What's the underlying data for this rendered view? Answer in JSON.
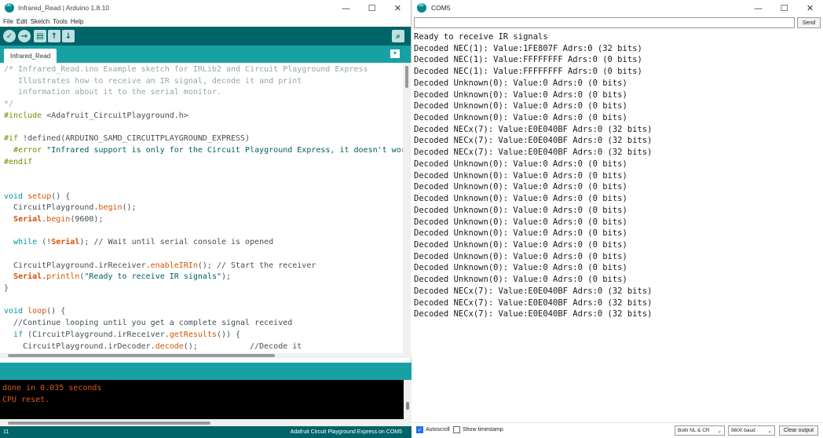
{
  "ide": {
    "title": "Infrared_Read | Arduino 1.8.10",
    "window_controls": [
      "—",
      "☐",
      "✕"
    ],
    "menu": [
      "File",
      "Edit",
      "Sketch",
      "Tools",
      "Help"
    ],
    "toolbar": {
      "verify": "✓",
      "upload": "→",
      "new": "▤",
      "open": "↑",
      "save": "↓",
      "serial_monitor": "⌕"
    },
    "tab_label": "Infrared_Read",
    "tab_menu_icon": "▼",
    "console_lines": [
      "done in 0.035 seconds",
      "CPU reset."
    ],
    "status_line": "11",
    "status_board": "Adafruit Circuit Playground Express on COM5"
  },
  "code_lines": [
    [
      {
        "t": "/* Infrared_Read.ino Example sketch for IRLib2 and Circuit Playground Express",
        "c": "com"
      }
    ],
    [
      {
        "t": "   Illustrates how to receive an IR signal, decode it and print",
        "c": "com"
      }
    ],
    [
      {
        "t": "   information about it to the serial monitor.",
        "c": "com"
      }
    ],
    [
      {
        "t": "*/",
        "c": "com"
      }
    ],
    [
      {
        "t": "#include ",
        "c": "pre"
      },
      {
        "t": "<Adafruit_CircuitPlayground.h>",
        "c": ""
      }
    ],
    [
      {
        "t": "",
        "c": ""
      }
    ],
    [
      {
        "t": "#if ",
        "c": "pre"
      },
      {
        "t": "!defined(ARDUINO_SAMD_CIRCUITPLAYGROUND_EXPRESS)",
        "c": ""
      }
    ],
    [
      {
        "t": "  #error ",
        "c": "pre"
      },
      {
        "t": "\"Infrared support is only for the Circuit Playground Express, it doesn't work with the Classic version\"",
        "c": "str"
      }
    ],
    [
      {
        "t": "#endif",
        "c": "pre"
      }
    ],
    [
      {
        "t": "",
        "c": ""
      }
    ],
    [
      {
        "t": "",
        "c": ""
      }
    ],
    [
      {
        "t": "void ",
        "c": "kw"
      },
      {
        "t": "setup",
        "c": "fn"
      },
      {
        "t": "() {",
        "c": ""
      }
    ],
    [
      {
        "t": "  CircuitPlayground.",
        "c": ""
      },
      {
        "t": "begin",
        "c": "fn"
      },
      {
        "t": "();",
        "c": ""
      }
    ],
    [
      {
        "t": "  ",
        "c": ""
      },
      {
        "t": "Serial",
        "c": "bold"
      },
      {
        "t": ".",
        "c": ""
      },
      {
        "t": "begin",
        "c": "fn"
      },
      {
        "t": "(9600);",
        "c": ""
      }
    ],
    [
      {
        "t": "",
        "c": ""
      }
    ],
    [
      {
        "t": "  ",
        "c": ""
      },
      {
        "t": "while",
        "c": "kw"
      },
      {
        "t": " (!",
        "c": ""
      },
      {
        "t": "Serial",
        "c": "bold"
      },
      {
        "t": "); // Wait until serial console is opened",
        "c": ""
      }
    ],
    [
      {
        "t": "",
        "c": ""
      }
    ],
    [
      {
        "t": "  CircuitPlayground.irReceiver.",
        "c": ""
      },
      {
        "t": "enableIRIn",
        "c": "fn"
      },
      {
        "t": "(); // Start the receiver",
        "c": ""
      }
    ],
    [
      {
        "t": "  ",
        "c": ""
      },
      {
        "t": "Serial",
        "c": "bold"
      },
      {
        "t": ".",
        "c": ""
      },
      {
        "t": "println",
        "c": "fn"
      },
      {
        "t": "(",
        "c": ""
      },
      {
        "t": "\"Ready to receive IR signals\"",
        "c": "str"
      },
      {
        "t": ");",
        "c": ""
      }
    ],
    [
      {
        "t": "}",
        "c": ""
      }
    ],
    [
      {
        "t": "",
        "c": ""
      }
    ],
    [
      {
        "t": "void ",
        "c": "kw"
      },
      {
        "t": "loop",
        "c": "fn"
      },
      {
        "t": "() {",
        "c": ""
      }
    ],
    [
      {
        "t": "  //Continue looping until you get a complete signal received",
        "c": ""
      }
    ],
    [
      {
        "t": "  ",
        "c": ""
      },
      {
        "t": "if",
        "c": "kw"
      },
      {
        "t": " (CircuitPlayground.irReceiver.",
        "c": ""
      },
      {
        "t": "getResults",
        "c": "fn"
      },
      {
        "t": "()) {",
        "c": ""
      }
    ],
    [
      {
        "t": "    CircuitPlayground.irDecoder.",
        "c": ""
      },
      {
        "t": "decode",
        "c": "fn"
      },
      {
        "t": "();           //Decode it",
        "c": ""
      }
    ]
  ],
  "monitor": {
    "title": "COM5",
    "window_controls": [
      "—",
      "☐",
      "✕"
    ],
    "input_value": "",
    "send_label": "Send",
    "output_lines": [
      "Ready to receive IR signals",
      "Decoded NEC(1): Value:1FE807F Adrs:0 (32 bits)",
      "Decoded NEC(1): Value:FFFFFFFF Adrs:0 (0 bits)",
      "Decoded NEC(1): Value:FFFFFFFF Adrs:0 (0 bits)",
      "Decoded Unknown(0): Value:0 Adrs:0 (0 bits)",
      "Decoded Unknown(0): Value:0 Adrs:0 (0 bits)",
      "Decoded Unknown(0): Value:0 Adrs:0 (0 bits)",
      "Decoded Unknown(0): Value:0 Adrs:0 (0 bits)",
      "Decoded NECx(7): Value:E0E040BF Adrs:0 (32 bits)",
      "Decoded NECx(7): Value:E0E040BF Adrs:0 (32 bits)",
      "Decoded NECx(7): Value:E0E040BF Adrs:0 (32 bits)",
      "Decoded Unknown(0): Value:0 Adrs:0 (0 bits)",
      "Decoded Unknown(0): Value:0 Adrs:0 (0 bits)",
      "Decoded Unknown(0): Value:0 Adrs:0 (0 bits)",
      "Decoded Unknown(0): Value:0 Adrs:0 (0 bits)",
      "Decoded Unknown(0): Value:0 Adrs:0 (0 bits)",
      "Decoded Unknown(0): Value:0 Adrs:0 (0 bits)",
      "Decoded Unknown(0): Value:0 Adrs:0 (0 bits)",
      "Decoded Unknown(0): Value:0 Adrs:0 (0 bits)",
      "Decoded Unknown(0): Value:0 Adrs:0 (0 bits)",
      "Decoded Unknown(0): Value:0 Adrs:0 (0 bits)",
      "Decoded Unknown(0): Value:0 Adrs:0 (0 bits)",
      "Decoded NECx(7): Value:E0E040BF Adrs:0 (32 bits)",
      "Decoded NECx(7): Value:E0E040BF Adrs:0 (32 bits)",
      "Decoded NECx(7): Value:E0E040BF Adrs:0 (32 bits)"
    ],
    "autoscroll_label": "Autoscroll",
    "autoscroll_checked": true,
    "timestamp_label": "Show timestamp",
    "timestamp_checked": false,
    "line_ending": "Both NL & CR",
    "baud": "9600 baud",
    "clear_label": "Clear output"
  },
  "colors": {
    "teal_dark": "#006468",
    "teal_light": "#17a1a5",
    "console_text": "#e05a1a"
  }
}
